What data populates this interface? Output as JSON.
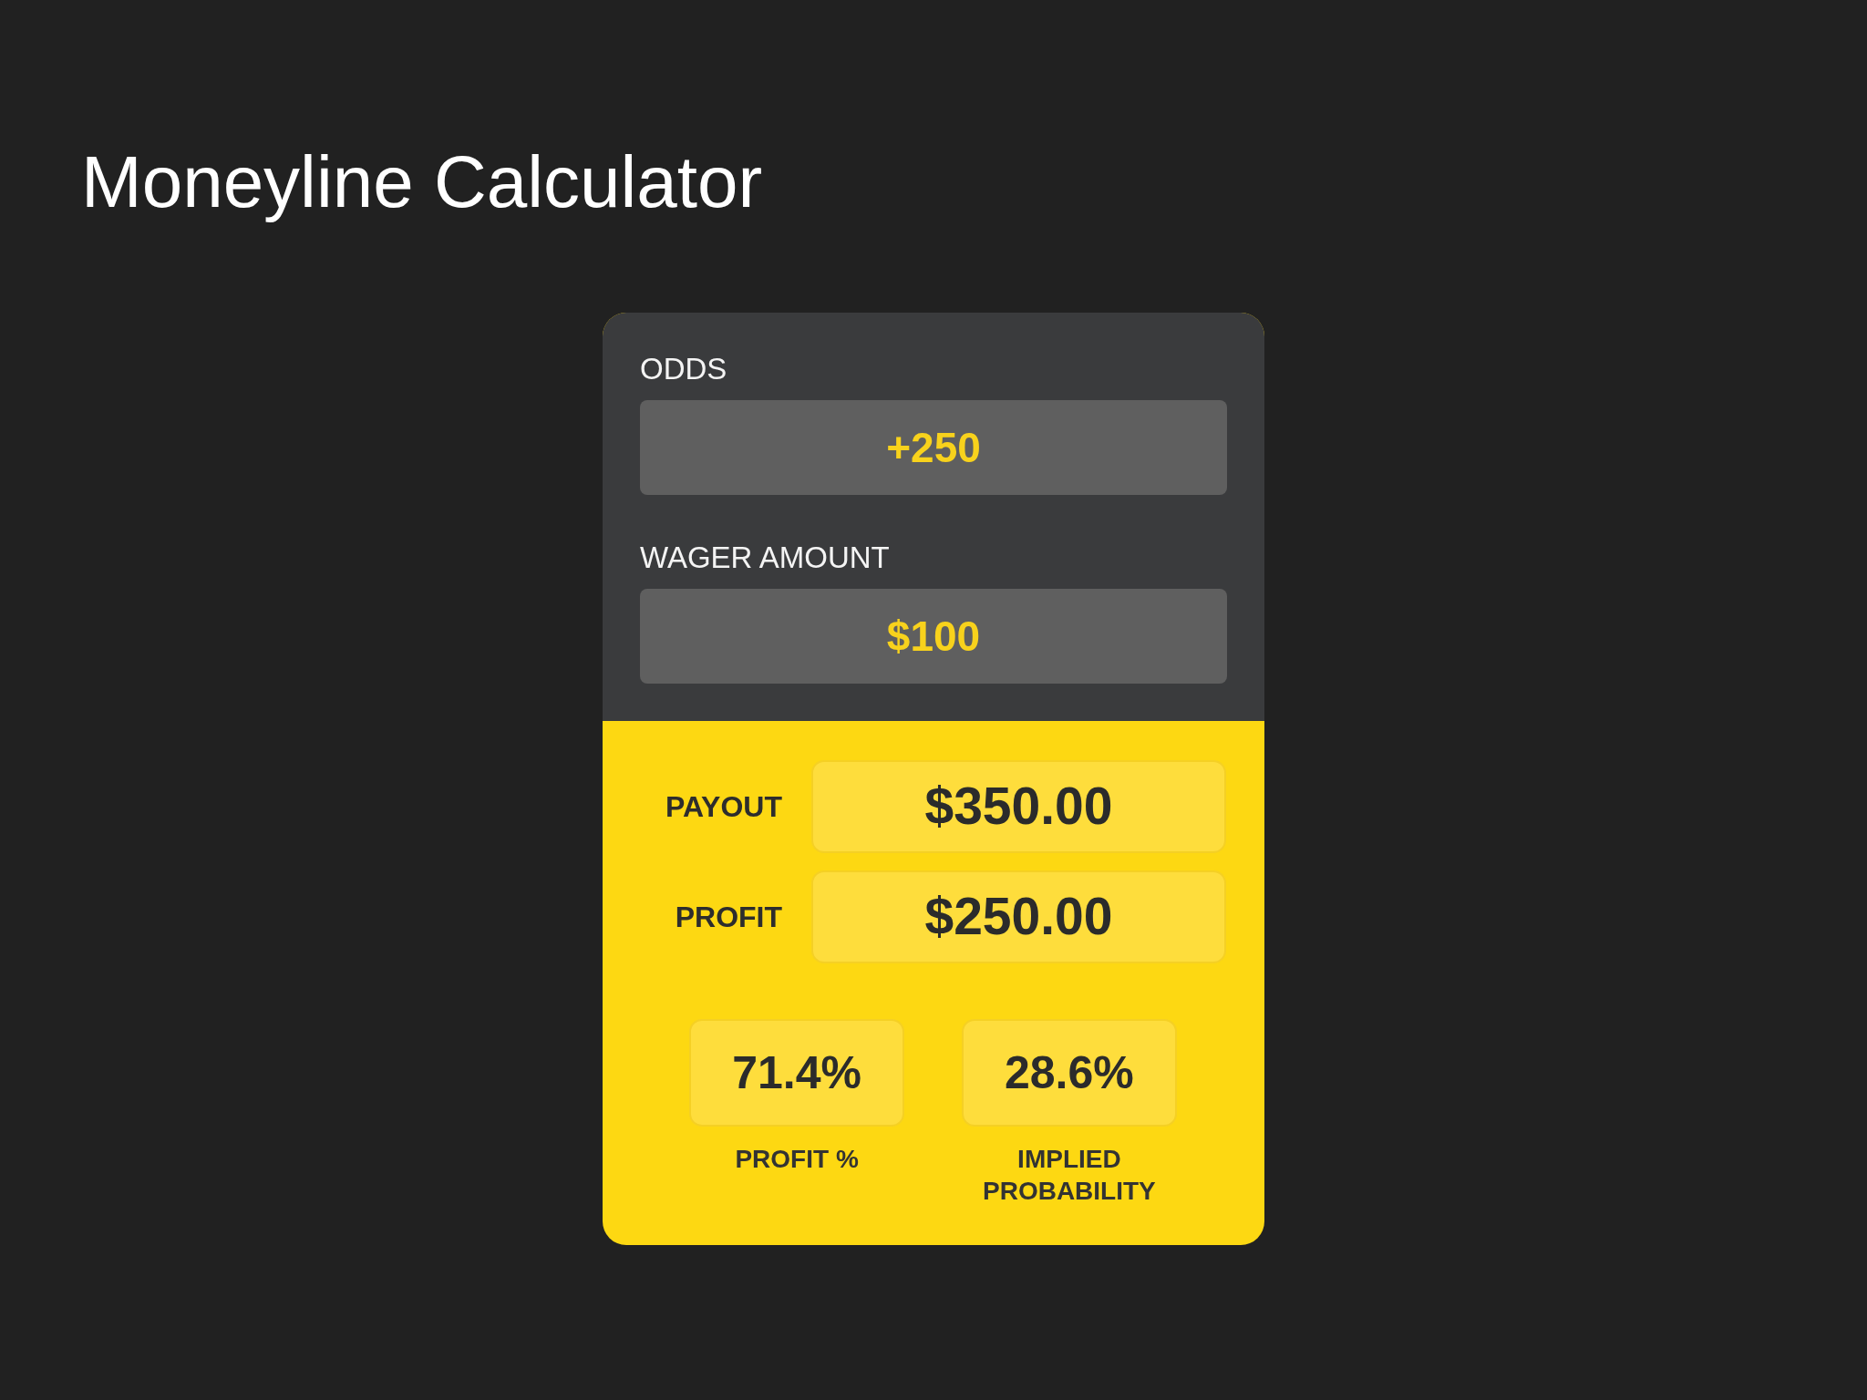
{
  "title": "Moneyline Calculator",
  "inputs": [
    {
      "label": "ODDS",
      "value": "+250"
    },
    {
      "label": "WAGER AMOUNT",
      "value": "$100"
    }
  ],
  "results": [
    {
      "label": "PAYOUT",
      "value": "$350.00"
    },
    {
      "label": "PROFIT",
      "value": "$250.00"
    }
  ],
  "stats": [
    {
      "value": "71.4%",
      "label": "PROFIT %"
    },
    {
      "value": "28.6%",
      "label": "IMPLIED PROBABILITY"
    }
  ]
}
